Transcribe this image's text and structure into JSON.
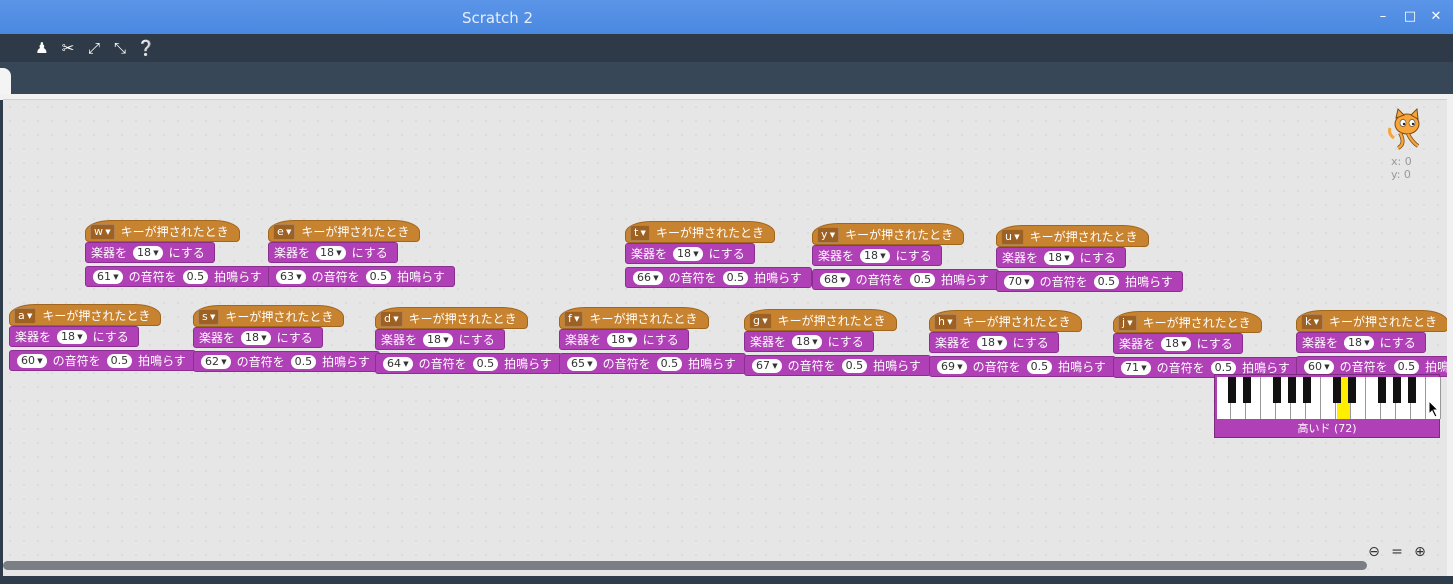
{
  "window": {
    "title": "Scratch 2"
  },
  "toolbar": {
    "icons": [
      "duplicate-icon",
      "delete-icon",
      "grow-icon",
      "shrink-icon",
      "help-icon"
    ]
  },
  "sprite": {
    "x_label": "x:",
    "x_value": "0",
    "y_label": "y:",
    "y_value": "0"
  },
  "block_text": {
    "when_key": "キーが押されたとき",
    "set_instrument_pre": "楽器を",
    "set_instrument_post": "にする",
    "note_pre": "の音符を",
    "note_post": "拍鳴らす"
  },
  "scripts": [
    {
      "key": "w",
      "instrument": "18",
      "note": "61",
      "beats": "0.5"
    },
    {
      "key": "e",
      "instrument": "18",
      "note": "63",
      "beats": "0.5"
    },
    {
      "key": "t",
      "instrument": "18",
      "note": "66",
      "beats": "0.5"
    },
    {
      "key": "y",
      "instrument": "18",
      "note": "68",
      "beats": "0.5"
    },
    {
      "key": "u",
      "instrument": "18",
      "note": "70",
      "beats": "0.5"
    },
    {
      "key": "a",
      "instrument": "18",
      "note": "60",
      "beats": "0.5"
    },
    {
      "key": "s",
      "instrument": "18",
      "note": "62",
      "beats": "0.5"
    },
    {
      "key": "d",
      "instrument": "18",
      "note": "64",
      "beats": "0.5"
    },
    {
      "key": "f",
      "instrument": "18",
      "note": "65",
      "beats": "0.5"
    },
    {
      "key": "g",
      "instrument": "18",
      "note": "67",
      "beats": "0.5"
    },
    {
      "key": "h",
      "instrument": "18",
      "note": "69",
      "beats": "0.5"
    },
    {
      "key": "j",
      "instrument": "18",
      "note": "71",
      "beats": "0.5"
    },
    {
      "key": "k",
      "instrument": "18",
      "note": "60",
      "beats": "0.5"
    }
  ],
  "piano": {
    "label": "高いド (72)",
    "selected_white_key": 8
  },
  "zoom": {
    "icons": [
      "zoom-out-icon",
      "zoom-reset-icon",
      "zoom-in-icon"
    ]
  }
}
